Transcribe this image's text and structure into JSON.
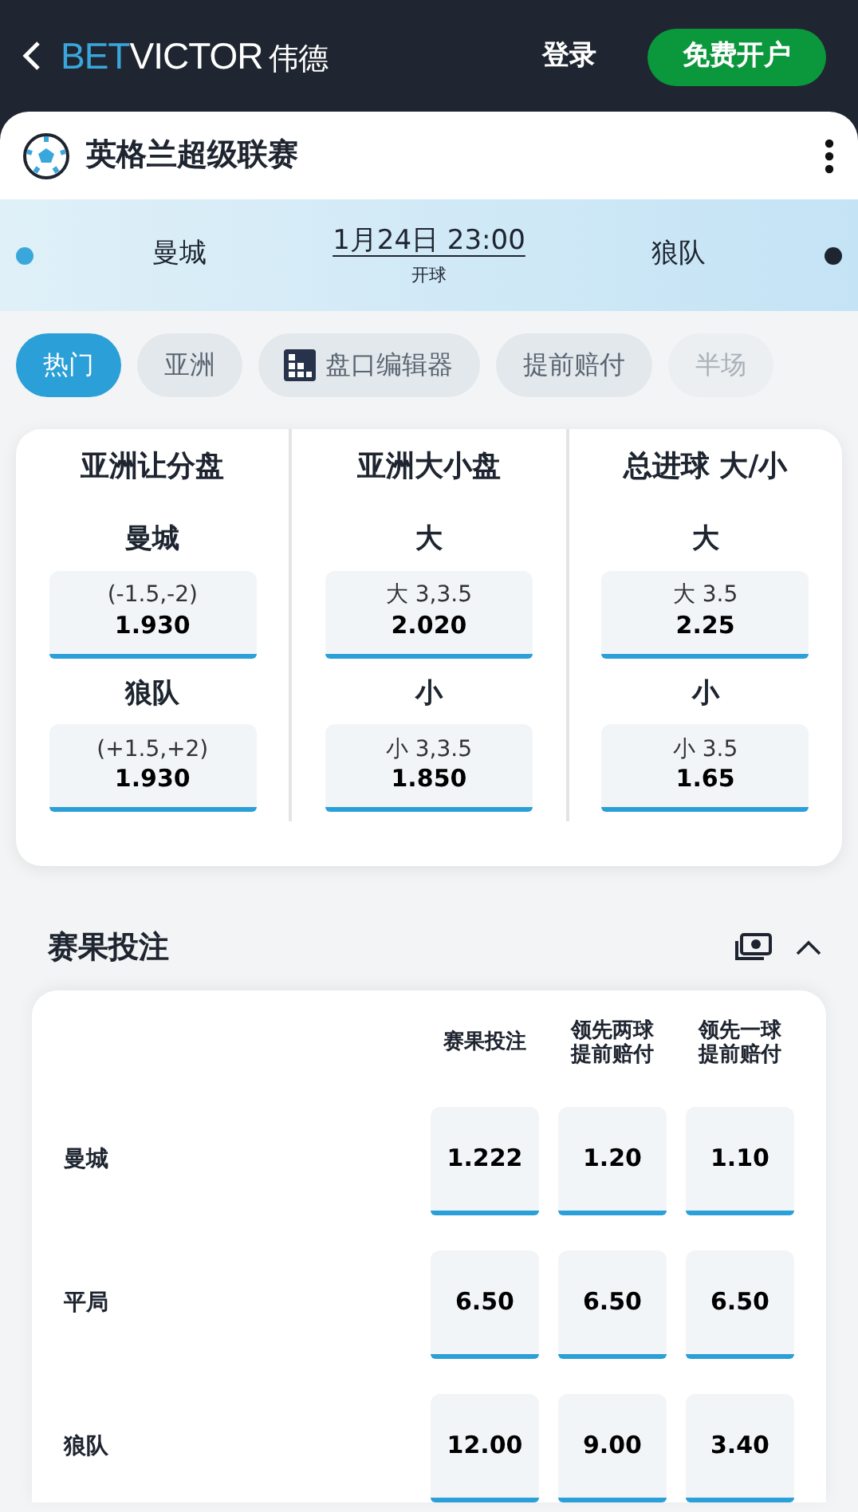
{
  "header": {
    "brand": {
      "accent": "BET",
      "rest": "VICTOR",
      "suffix": "伟德"
    },
    "login": "登录",
    "signup": "免费开户"
  },
  "league": {
    "title": "英格兰超级联赛"
  },
  "match": {
    "home": {
      "name": "曼城",
      "color": "#3aa7dc"
    },
    "away": {
      "name": "狼队",
      "color": "#1e2530"
    },
    "datetime": "1月24日 23:00",
    "status": "开球"
  },
  "tabs": [
    {
      "label": "热门",
      "selected": true,
      "kind": "plain"
    },
    {
      "label": "亚洲",
      "selected": false,
      "kind": "plain"
    },
    {
      "label": "盘口编辑器",
      "selected": false,
      "kind": "grid"
    },
    {
      "label": "提前赔付",
      "selected": false,
      "kind": "plain"
    },
    {
      "label": "半场",
      "selected": false,
      "kind": "faded"
    }
  ],
  "markets": [
    {
      "title": "亚洲让分盘",
      "outcomes": [
        {
          "label": "曼城",
          "line": "(-1.5,-2)",
          "price": "1.930"
        },
        {
          "label": "狼队",
          "line": "(+1.5,+2)",
          "price": "1.930"
        }
      ]
    },
    {
      "title": "亚洲大小盘",
      "outcomes": [
        {
          "label": "大",
          "line": "大 3,3.5",
          "price": "2.020"
        },
        {
          "label": "小",
          "line": "小 3,3.5",
          "price": "1.850"
        }
      ]
    },
    {
      "title": "总进球 大/小",
      "outcomes": [
        {
          "label": "大",
          "line": "大 3.5",
          "price": "2.25"
        },
        {
          "label": "小",
          "line": "小 3.5",
          "price": "1.65"
        }
      ]
    }
  ],
  "result_section": {
    "title": "赛果投注",
    "expanded": true,
    "columns": [
      [
        "赛果投注"
      ],
      [
        "领先两球",
        "提前赔付"
      ],
      [
        "领先一球",
        "提前赔付"
      ]
    ],
    "rows": [
      {
        "name": "曼城",
        "prices": [
          "1.222",
          "1.20",
          "1.10"
        ]
      },
      {
        "name": "平局",
        "prices": [
          "6.50",
          "6.50",
          "6.50"
        ]
      },
      {
        "name": "狼队",
        "prices": [
          "12.00",
          "9.00",
          "3.40"
        ]
      }
    ]
  }
}
